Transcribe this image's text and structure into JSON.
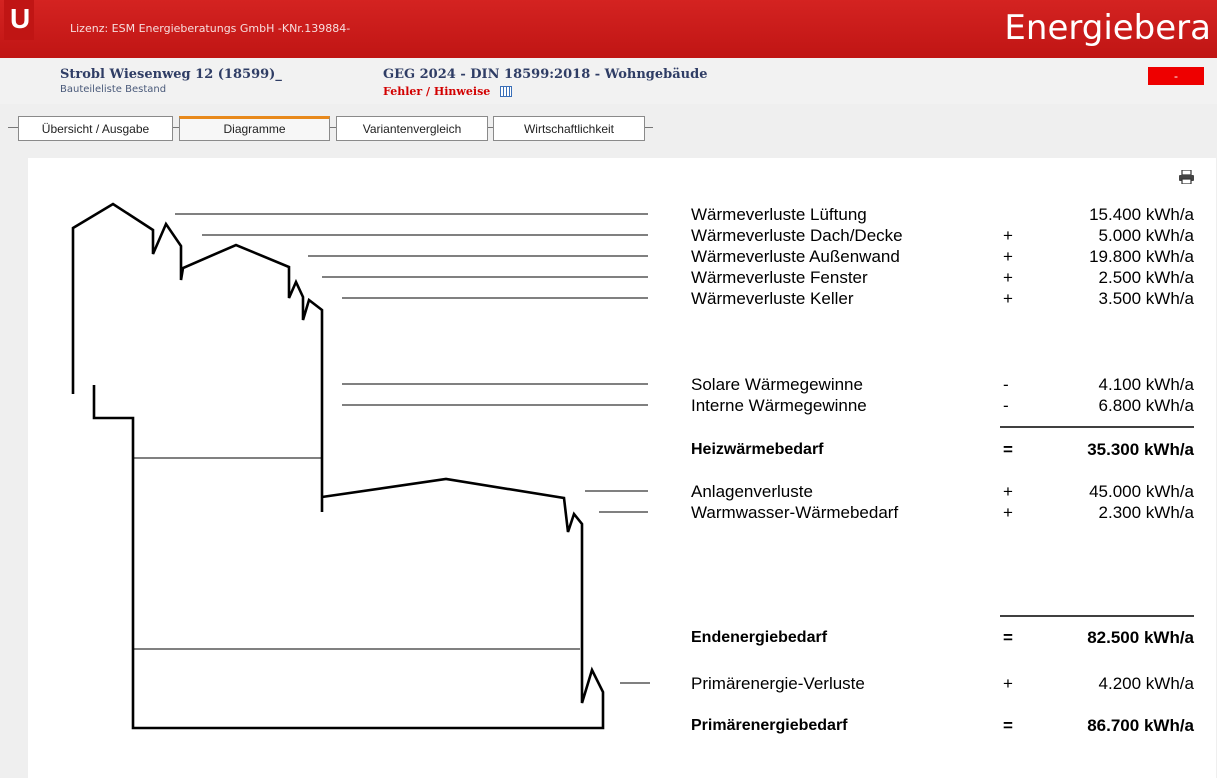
{
  "header": {
    "license": "Lizenz: ESM Energieberatungs GmbH  -KNr.139884-",
    "brand": "Energiebera",
    "logo_letter": "U"
  },
  "project": {
    "title": "Strobl Wiesenweg 12  (18599)_",
    "subtitle": "Bauteileliste Bestand",
    "standard": "GEG 2024 - DIN 18599:2018  -  Wohngebäude",
    "errors_link": "Fehler / Hinweise",
    "status_badge": "-"
  },
  "tabs": [
    {
      "label": "Übersicht / Ausgabe",
      "active": false
    },
    {
      "label": "Diagramme",
      "active": true
    },
    {
      "label": "Variantenvergleich",
      "active": false
    },
    {
      "label": "Wirtschaftlichkeit",
      "active": false
    }
  ],
  "energy_balance": {
    "rows": [
      {
        "label": "Wärmeverluste Lüftung",
        "op": "",
        "value": "15.400 kWh/a"
      },
      {
        "label": "Wärmeverluste Dach/Decke",
        "op": "+",
        "value": "5.000 kWh/a"
      },
      {
        "label": "Wärmeverluste Außenwand",
        "op": "+",
        "value": "19.800 kWh/a"
      },
      {
        "label": "Wärmeverluste Fenster",
        "op": "+",
        "value": "2.500 kWh/a"
      },
      {
        "label": "Wärmeverluste Keller",
        "op": "+",
        "value": "3.500 kWh/a"
      },
      {
        "label": "Solare Wärmegewinne",
        "op": "-",
        "value": "4.100 kWh/a"
      },
      {
        "label": "Interne Wärmegewinne",
        "op": "-",
        "value": "6.800 kWh/a"
      },
      {
        "label": "Heizwärmebedarf",
        "op": "=",
        "value": "35.300 kWh/a"
      },
      {
        "label": "Anlagenverluste",
        "op": "+",
        "value": "45.000 kWh/a"
      },
      {
        "label": "Warmwasser-Wärmebedarf",
        "op": "+",
        "value": "2.300 kWh/a"
      },
      {
        "label": "Endenergiebedarf",
        "op": "=",
        "value": "82.500 kWh/a"
      },
      {
        "label": "Primärenergie-Verluste",
        "op": "+",
        "value": "4.200 kWh/a"
      },
      {
        "label": "Primärenergiebedarf",
        "op": "=",
        "value": "86.700 kWh/a"
      }
    ]
  },
  "icons": {
    "print": "printer-icon",
    "errors": "calendar-icon"
  },
  "colors": {
    "brand_red": "#c8191a",
    "accent_orange": "#e8891c",
    "title_navy": "#2f3d65",
    "error_red": "#d20000"
  }
}
